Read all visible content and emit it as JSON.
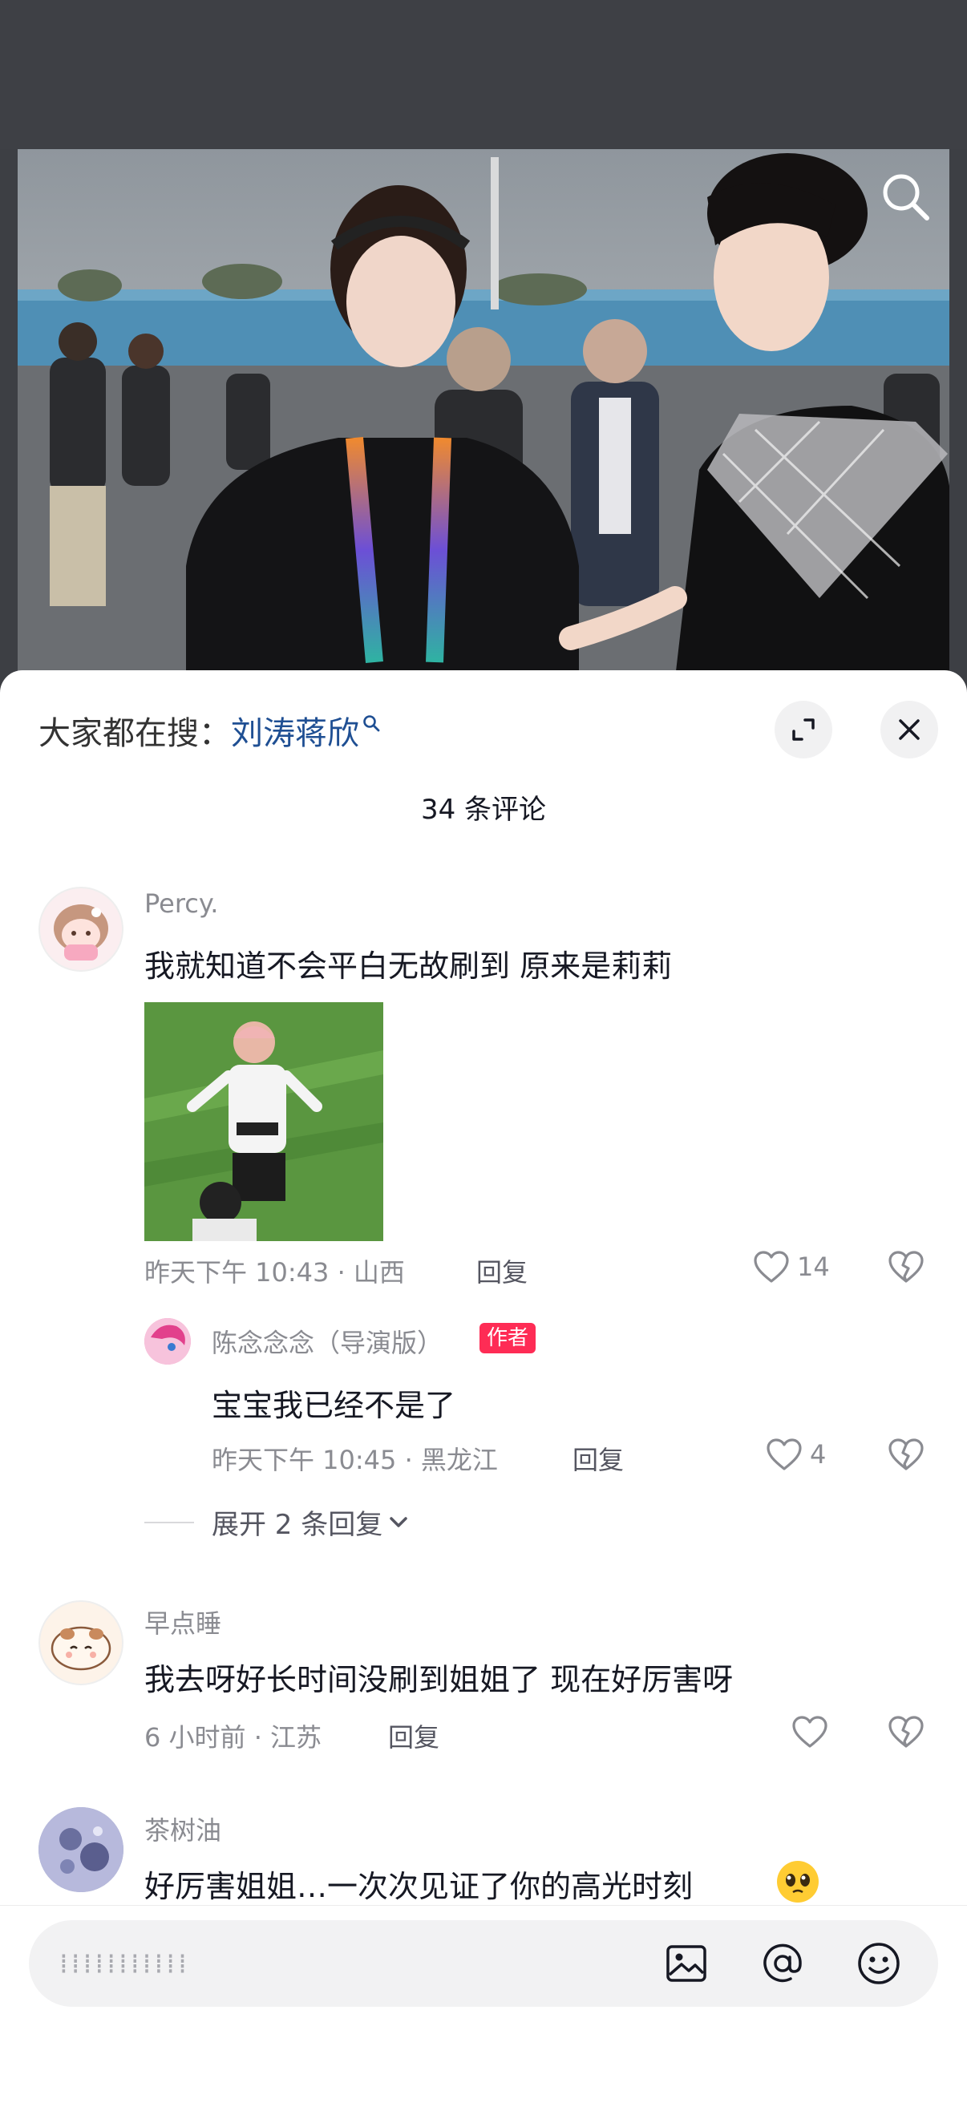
{
  "sheet": {
    "trending_prefix": "大家都在搜：",
    "trending_keyword": "刘涛蒋欣",
    "comment_count": "34 条评论"
  },
  "comments": [
    {
      "nickname": "Percy.",
      "text": "我就知道不会平白无故刷到  原来是莉莉",
      "time": "昨天下午 10:43 · 山西",
      "reply_label": "回复",
      "likes": "14",
      "replies": [
        {
          "nickname": "陈念念念（导演版）",
          "badge": "作者",
          "text": "宝宝我已经不是了",
          "time": "昨天下午 10:45 · 黑龙江",
          "reply_label": "回复",
          "likes": "4"
        }
      ],
      "expand_label": "展开 2 条回复"
    },
    {
      "nickname": "早点睡",
      "text": "我去呀好长时间没刷到姐姐了 现在好厉害呀",
      "time": "6 小时前 · 江苏",
      "reply_label": "回复"
    },
    {
      "nickname": "茶树油",
      "text": "好厉害姐姐…一次次见证了你的高光时刻"
    }
  ],
  "input": {
    "placeholder": "⁞⁞⁞⁞⁞⁞⁞⁞⁞⁞⁞"
  },
  "icons": {
    "photo_search": "search-icon",
    "expand": "expand-icon",
    "close": "close-icon",
    "like": "heart-icon",
    "dislike": "broken-heart-icon",
    "image": "image-icon",
    "mention": "at-icon",
    "emoji": "emoji-icon"
  },
  "colors": {
    "keyword": "#1f4f93",
    "badge": "#fe2c55",
    "meta": "#8a8b91"
  }
}
